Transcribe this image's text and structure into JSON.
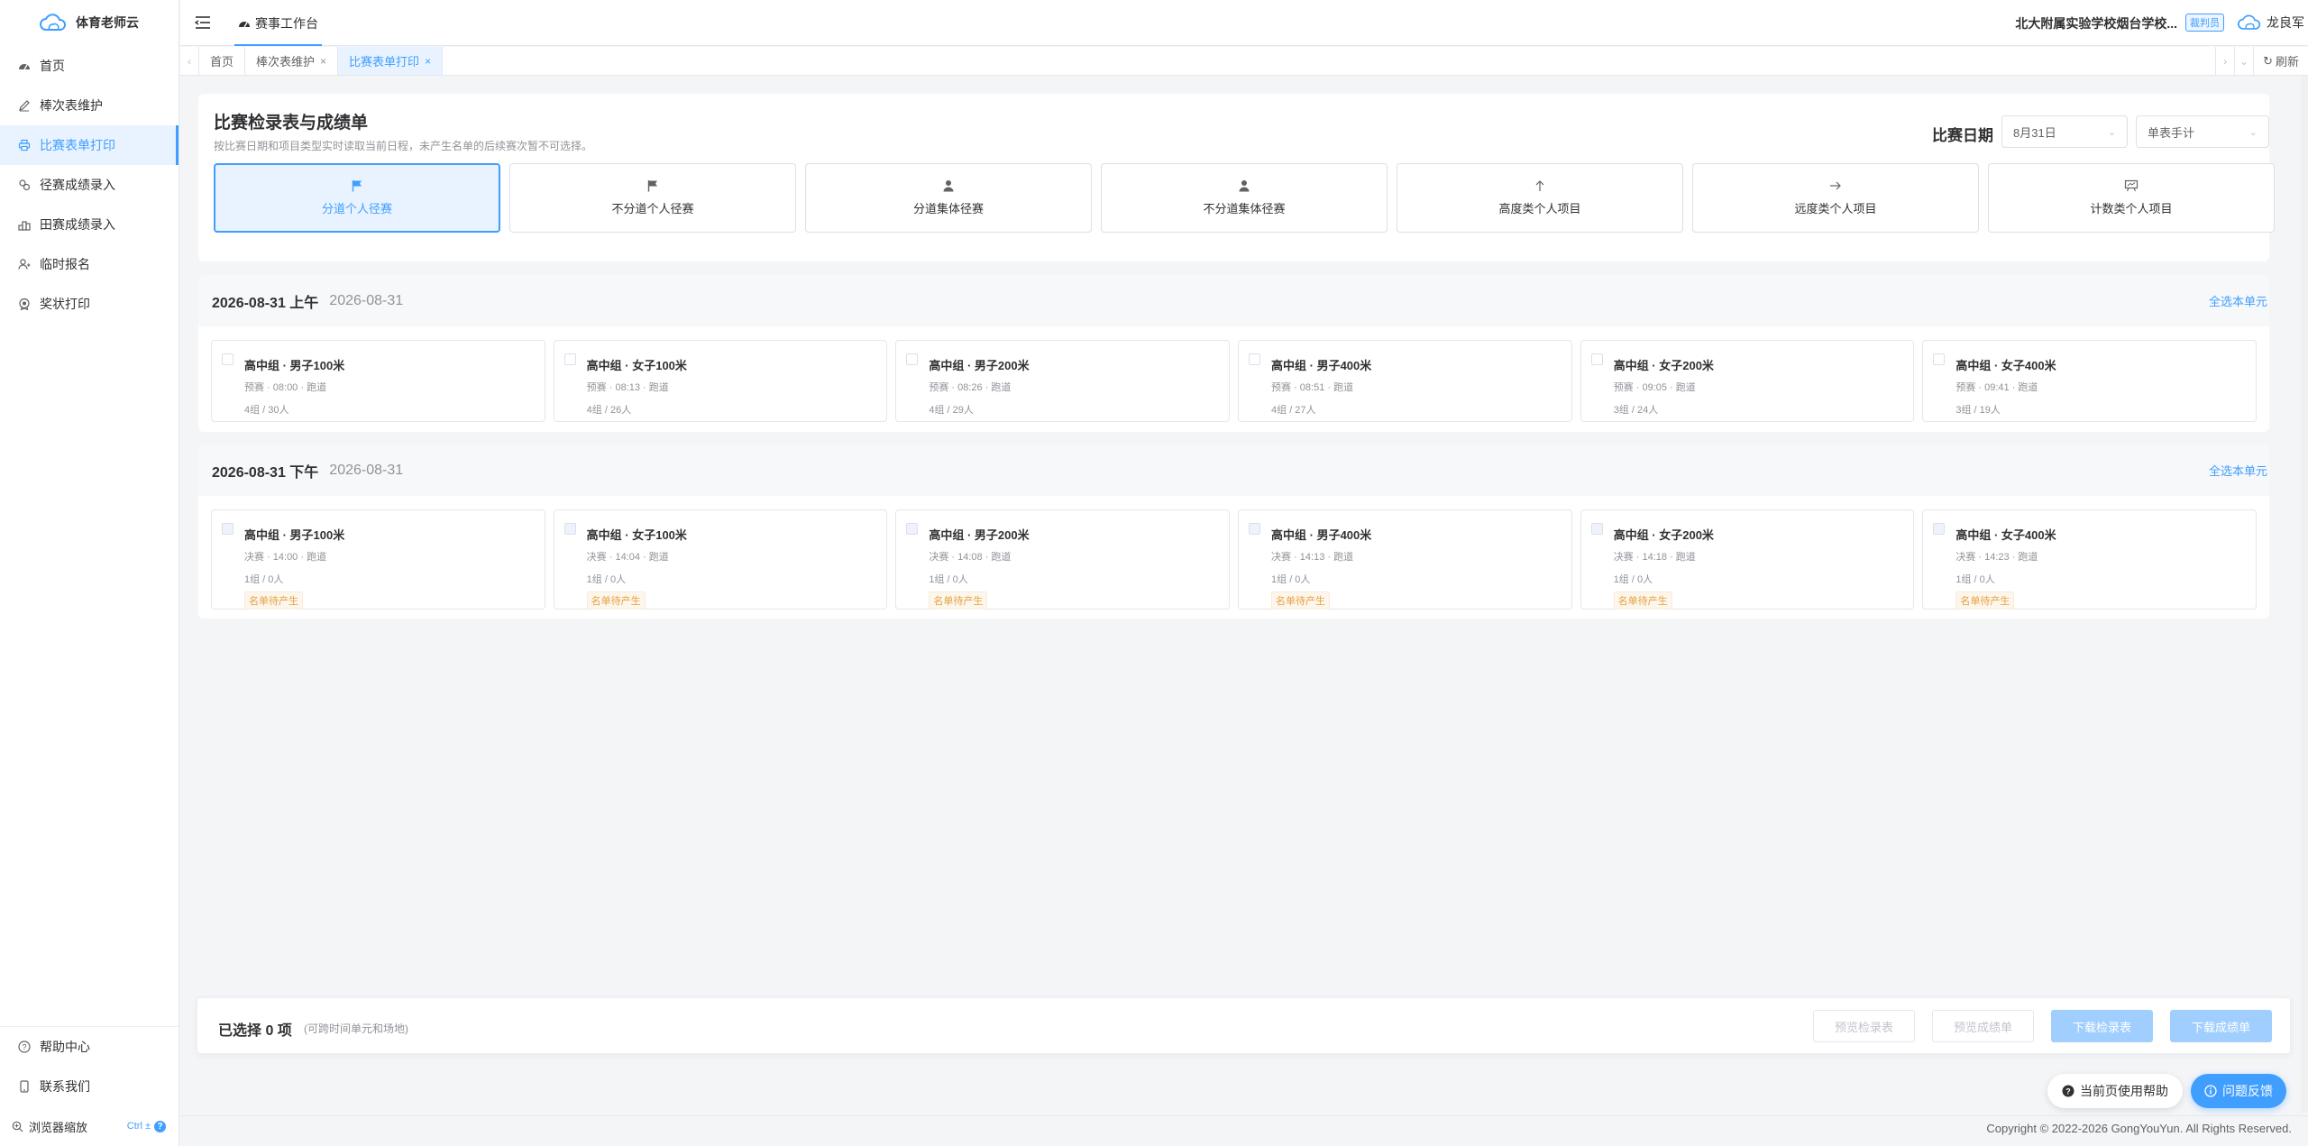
{
  "app": {
    "name": "体育老师云"
  },
  "sidebar": {
    "items": [
      {
        "label": "首页",
        "icon": "dashboard-icon"
      },
      {
        "label": "棒次表维护",
        "icon": "edit-icon"
      },
      {
        "label": "比赛表单打印",
        "icon": "printer-icon",
        "active": true
      },
      {
        "label": "径赛成绩录入",
        "icon": "track-icon"
      },
      {
        "label": "田赛成绩录入",
        "icon": "field-icon"
      },
      {
        "label": "临时报名",
        "icon": "user-add-icon"
      },
      {
        "label": "奖状打印",
        "icon": "award-icon"
      }
    ],
    "bottom": {
      "help": "帮助中心",
      "contact": "联系我们",
      "zoom": "浏览器缩放",
      "zoom_shortcut": "Ctrl ±"
    }
  },
  "topbar": {
    "nav_label": "赛事工作台",
    "org": "北大附属实验学校烟台学校...",
    "role": "裁判员",
    "user": "龙良军"
  },
  "tabs": {
    "items": [
      {
        "label": "首页",
        "closable": false
      },
      {
        "label": "棒次表维护",
        "closable": true
      },
      {
        "label": "比赛表单打印",
        "closable": true,
        "active": true
      }
    ],
    "refresh": "刷新"
  },
  "main": {
    "title": "比赛检录表与成绩单",
    "subtitle": "按比赛日期和项目类型实时读取当前日程，未产生名单的后续赛次暂不可选择。",
    "date_label": "比赛日期",
    "date_value": "8月31日",
    "print_mode": "单表手计",
    "types": [
      {
        "label": "分道个人径赛",
        "icon": "flag-icon",
        "active": true
      },
      {
        "label": "不分道个人径赛",
        "icon": "flag-icon"
      },
      {
        "label": "分道集体径赛",
        "icon": "user-icon"
      },
      {
        "label": "不分道集体径赛",
        "icon": "user-icon"
      },
      {
        "label": "高度类个人项目",
        "icon": "arrow-up-icon"
      },
      {
        "label": "远度类个人项目",
        "icon": "arrow-right-icon"
      },
      {
        "label": "计数类个人项目",
        "icon": "board-icon"
      }
    ]
  },
  "sessions": [
    {
      "title": "2026-08-31 上午",
      "date": "2026-08-31",
      "select_all": "全选本单元",
      "units": [
        {
          "name": "高中组 · 男子100米",
          "meta": "预赛 · 08:00 · 跑道",
          "stat": "4组 / 30人",
          "badge": ""
        },
        {
          "name": "高中组 · 女子100米",
          "meta": "预赛 · 08:13 · 跑道",
          "stat": "4组 / 26人",
          "badge": ""
        },
        {
          "name": "高中组 · 男子200米",
          "meta": "预赛 · 08:26 · 跑道",
          "stat": "4组 / 29人",
          "badge": ""
        },
        {
          "name": "高中组 · 男子400米",
          "meta": "预赛 · 08:51 · 跑道",
          "stat": "4组 / 27人",
          "badge": ""
        },
        {
          "name": "高中组 · 女子200米",
          "meta": "预赛 · 09:05 · 跑道",
          "stat": "3组 / 24人",
          "badge": ""
        },
        {
          "name": "高中组 · 女子400米",
          "meta": "预赛 · 09:41 · 跑道",
          "stat": "3组 / 19人",
          "badge": ""
        }
      ]
    },
    {
      "title": "2026-08-31 下午",
      "date": "2026-08-31",
      "select_all": "全选本单元",
      "units": [
        {
          "name": "高中组 · 男子100米",
          "meta": "决赛 · 14:00 · 跑道",
          "stat": "1组 / 0人",
          "badge": "名单待产生"
        },
        {
          "name": "高中组 · 女子100米",
          "meta": "决赛 · 14:04 · 跑道",
          "stat": "1组 / 0人",
          "badge": "名单待产生"
        },
        {
          "name": "高中组 · 男子200米",
          "meta": "决赛 · 14:08 · 跑道",
          "stat": "1组 / 0人",
          "badge": "名单待产生"
        },
        {
          "name": "高中组 · 男子400米",
          "meta": "决赛 · 14:13 · 跑道",
          "stat": "1组 / 0人",
          "badge": "名单待产生"
        },
        {
          "name": "高中组 · 女子200米",
          "meta": "决赛 · 14:18 · 跑道",
          "stat": "1组 / 0人",
          "badge": "名单待产生"
        },
        {
          "name": "高中组 · 女子400米",
          "meta": "决赛 · 14:23 · 跑道",
          "stat": "1组 / 0人",
          "badge": "名单待产生"
        }
      ]
    }
  ],
  "footer": {
    "selected": "已选择 0 项",
    "hint": "(可跨时间单元和场地)",
    "preview_checkin": "预览检录表",
    "preview_result": "预览成绩单",
    "download_checkin": "下载检录表",
    "download_result": "下载成绩单"
  },
  "floating": {
    "help": "当前页使用帮助",
    "feedback": "问题反馈"
  },
  "copyright": "Copyright © 2022-2026 GongYouYun. All Rights Reserved.",
  "colors": {
    "primary": "#409eff",
    "warning": "#e6a23c",
    "background": "#f4f5f7"
  }
}
